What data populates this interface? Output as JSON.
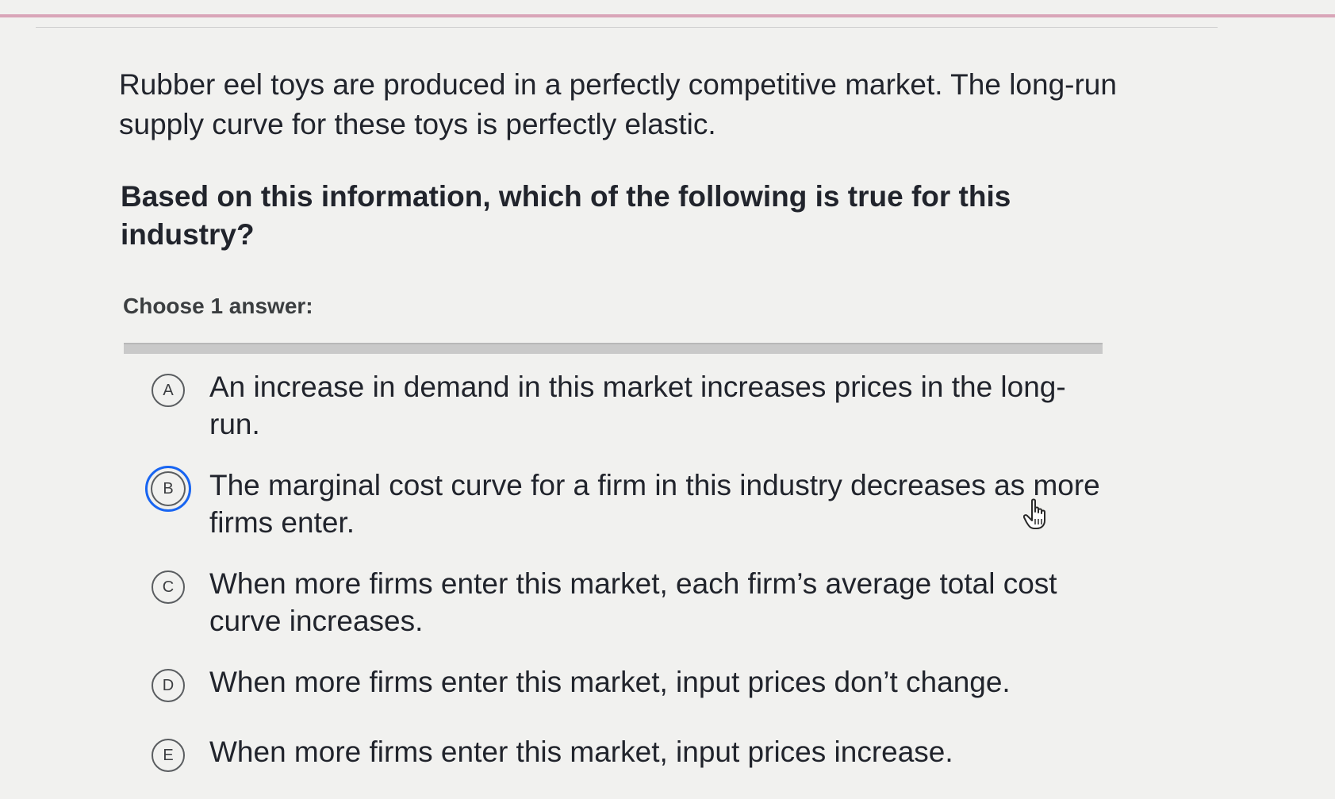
{
  "question": {
    "stem": "Rubber eel toys are produced in a perfectly competitive market. The long-run supply curve for these toys is perfectly elastic.",
    "prompt": "Based on this information, which of the following is true for this industry?",
    "choose_label": "Choose 1 answer:"
  },
  "choices": [
    {
      "letter": "A",
      "text": "An increase in demand in this market increases prices in the long-run.",
      "selected": false
    },
    {
      "letter": "B",
      "text": "The marginal cost curve for a firm in this industry decreases as more firms enter.",
      "selected": true
    },
    {
      "letter": "C",
      "text": "When more firms enter this market, each firm’s average total cost curve increases.",
      "selected": false
    },
    {
      "letter": "D",
      "text": "When more firms enter this market, input prices don’t change.",
      "selected": false
    },
    {
      "letter": "E",
      "text": "When more firms enter this market, input prices increase.",
      "selected": false
    }
  ],
  "colors": {
    "selected_ring": "#1865f2",
    "text": "#21242c",
    "background": "#f1f1ef"
  },
  "cursor": "hand-pointer-icon"
}
